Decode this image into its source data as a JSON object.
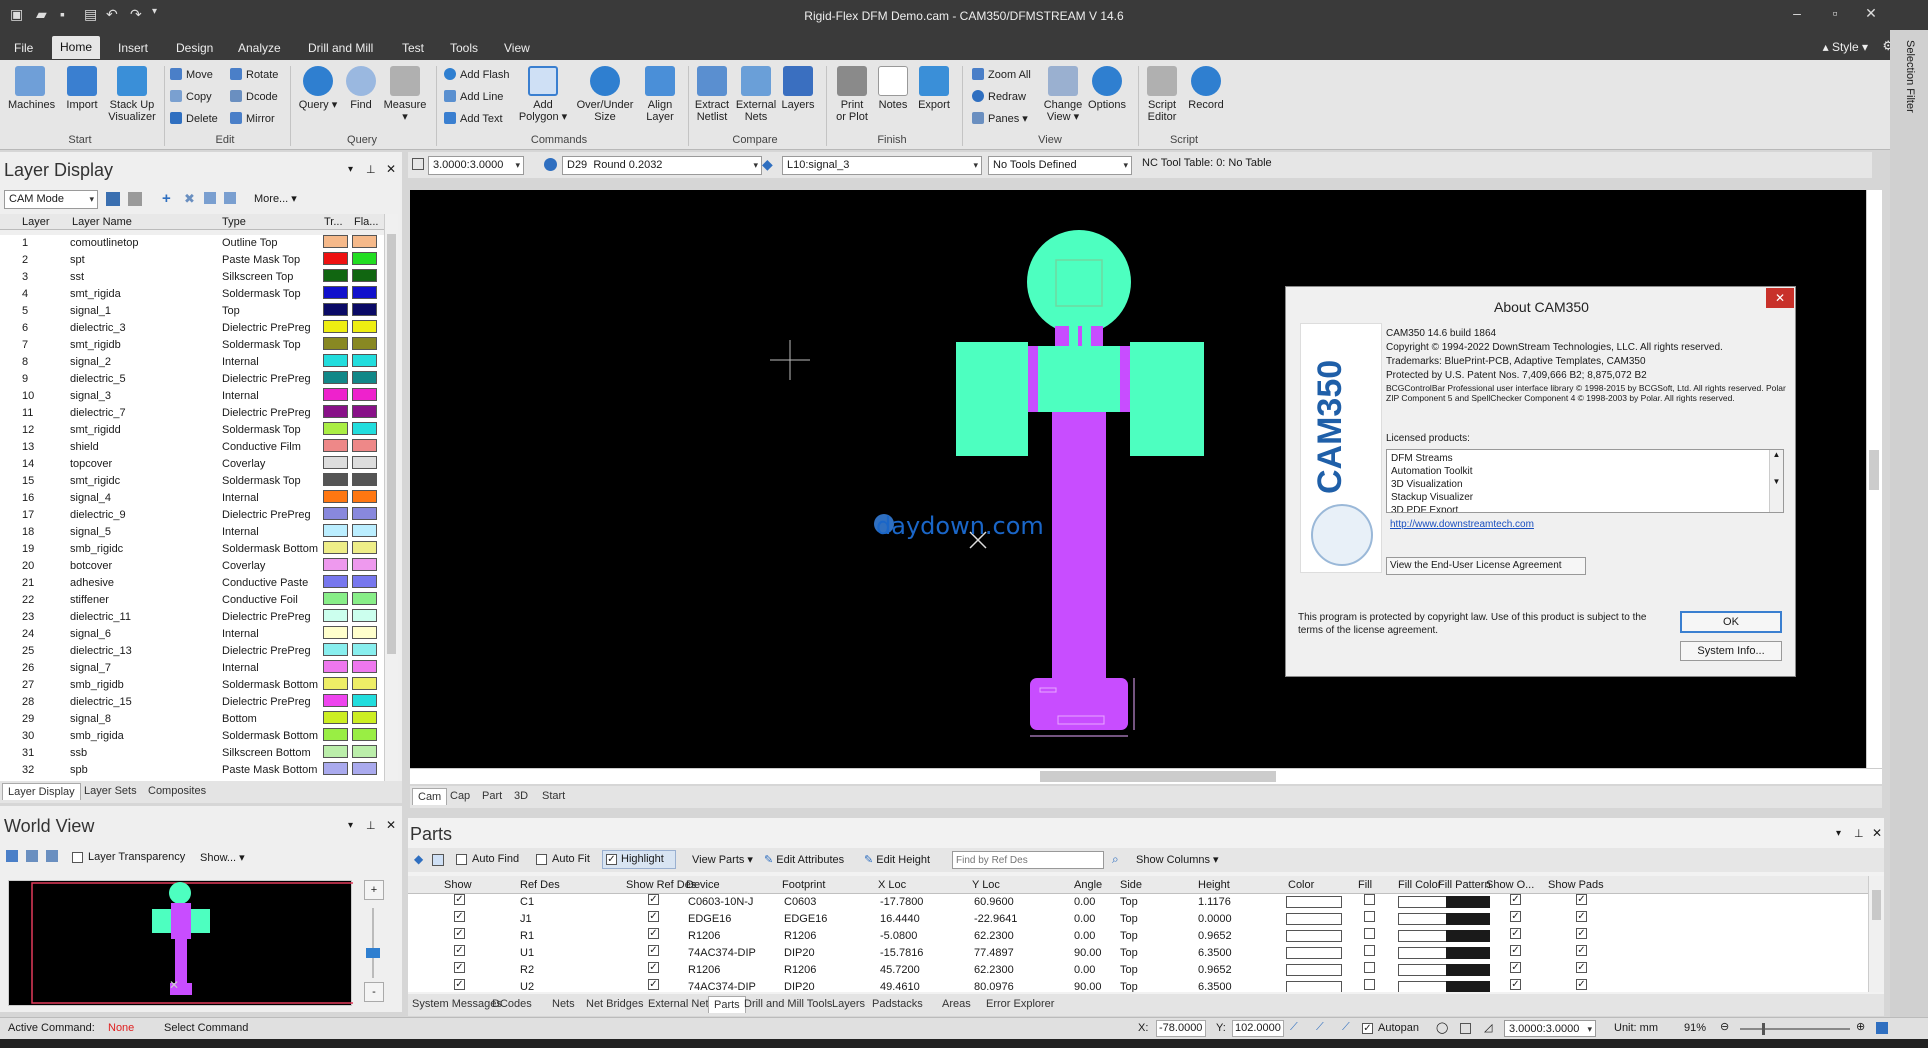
{
  "title": "Rigid-Flex DFM Demo.cam - CAM350/DFMSTREAM V 14.6",
  "menu": {
    "items": [
      "File",
      "Home",
      "Insert",
      "Design",
      "Analyze",
      "Drill and Mill",
      "Test",
      "Tools",
      "View"
    ],
    "style": "Style"
  },
  "ribbon": {
    "start": {
      "label": "Start",
      "machines": "Machines",
      "import": "Import",
      "stackup": "Stack Up",
      "visualizer": "Visualizer"
    },
    "edit": {
      "label": "Edit",
      "move": "Move",
      "copy": "Copy",
      "delete": "Delete",
      "rotate": "Rotate",
      "dcode": "Dcode",
      "mirror": "Mirror"
    },
    "query": {
      "label": "Query",
      "query": "Query",
      "find": "Find",
      "measure": "Measure"
    },
    "commands": {
      "label": "Commands",
      "add_flash": "Add Flash",
      "add_line": "Add Line",
      "add_text": "Add Text",
      "add": "Add",
      "polygon": "Polygon",
      "over_under": "Over/Under",
      "size": "Size",
      "align": "Align",
      "layer": "Layer"
    },
    "compare": {
      "label": "Compare",
      "extract": "Extract",
      "netlist": "Netlist",
      "external": "External",
      "nets": "Nets",
      "layers": "Layers"
    },
    "finish": {
      "label": "Finish",
      "print": "Print",
      "or_plot": "or Plot",
      "notes": "Notes",
      "export": "Export"
    },
    "view": {
      "label": "View",
      "zoom_all": "Zoom All",
      "redraw": "Redraw",
      "panes": "Panes",
      "change": "Change",
      "view": "View",
      "options": "Options"
    },
    "script": {
      "label": "Script",
      "script": "Script",
      "editor": "Editor",
      "record": "Record"
    }
  },
  "layer_display": {
    "title": "Layer Display",
    "mode": "CAM Mode",
    "more": "More...",
    "col_layer": "Layer",
    "col_name": "Layer Name",
    "col_type": "Type",
    "col_tr": "Tr...",
    "col_fla": "Fla...",
    "rows": [
      {
        "n": "1",
        "name": "comoutlinetop",
        "type": "Outline Top",
        "c1": "#f5b98a",
        "c2": "#f5b98a"
      },
      {
        "n": "2",
        "name": "spt",
        "type": "Paste Mask Top",
        "c1": "#ee1111",
        "c2": "#22dd22"
      },
      {
        "n": "3",
        "name": "sst",
        "type": "Silkscreen Top",
        "c1": "#116611",
        "c2": "#116611"
      },
      {
        "n": "4",
        "name": "smt_rigida",
        "type": "Soldermask Top",
        "c1": "#1111cc",
        "c2": "#1111cc"
      },
      {
        "n": "5",
        "name": "signal_1",
        "type": "Top",
        "c1": "#0a0a66",
        "c2": "#0a0a66"
      },
      {
        "n": "6",
        "name": "dielectric_3",
        "type": "Dielectric PrePreg",
        "c1": "#eeee11",
        "c2": "#eeee11"
      },
      {
        "n": "7",
        "name": "smt_rigidb",
        "type": "Soldermask Top",
        "c1": "#888822",
        "c2": "#888822"
      },
      {
        "n": "8",
        "name": "signal_2",
        "type": "Internal",
        "c1": "#22dddd",
        "c2": "#22dddd"
      },
      {
        "n": "9",
        "name": "dielectric_5",
        "type": "Dielectric PrePreg",
        "c1": "#118888",
        "c2": "#118888"
      },
      {
        "n": "10",
        "name": "signal_3",
        "type": "Internal",
        "c1": "#ee22cc",
        "c2": "#ee22cc"
      },
      {
        "n": "11",
        "name": "dielectric_7",
        "type": "Dielectric PrePreg",
        "c1": "#881188",
        "c2": "#881188"
      },
      {
        "n": "12",
        "name": "smt_rigidd",
        "type": "Soldermask Top",
        "c1": "#aaee44",
        "c2": "#22dddd"
      },
      {
        "n": "13",
        "name": "shield",
        "type": "Conductive Film",
        "c1": "#ee8888",
        "c2": "#ee8888"
      },
      {
        "n": "14",
        "name": "topcover",
        "type": "Coverlay",
        "c1": "#dddddd",
        "c2": "#dddddd"
      },
      {
        "n": "15",
        "name": "smt_rigidc",
        "type": "Soldermask Top",
        "c1": "#555555",
        "c2": "#555555"
      },
      {
        "n": "16",
        "name": "signal_4",
        "type": "Internal",
        "c1": "#ff7711",
        "c2": "#ff7711"
      },
      {
        "n": "17",
        "name": "dielectric_9",
        "type": "Dielectric PrePreg",
        "c1": "#8888dd",
        "c2": "#8888dd"
      },
      {
        "n": "18",
        "name": "signal_5",
        "type": "Internal",
        "c1": "#bbeeff",
        "c2": "#bbeeff"
      },
      {
        "n": "19",
        "name": "smb_rigidc",
        "type": "Soldermask Bottom",
        "c1": "#eeee88",
        "c2": "#eeee88"
      },
      {
        "n": "20",
        "name": "botcover",
        "type": "Coverlay",
        "c1": "#ee99ee",
        "c2": "#ee99ee"
      },
      {
        "n": "21",
        "name": "adhesive",
        "type": "Conductive Paste",
        "c1": "#7777ee",
        "c2": "#7777ee"
      },
      {
        "n": "22",
        "name": "stiffener",
        "type": "Conductive Foil",
        "c1": "#88ee88",
        "c2": "#88ee88"
      },
      {
        "n": "23",
        "name": "dielectric_11",
        "type": "Dielectric PrePreg",
        "c1": "#ccffee",
        "c2": "#ccffee"
      },
      {
        "n": "24",
        "name": "signal_6",
        "type": "Internal",
        "c1": "#ffffcc",
        "c2": "#ffffcc"
      },
      {
        "n": "25",
        "name": "dielectric_13",
        "type": "Dielectric PrePreg",
        "c1": "#88eeee",
        "c2": "#88eeee"
      },
      {
        "n": "26",
        "name": "signal_7",
        "type": "Internal",
        "c1": "#ee77ee",
        "c2": "#ee77ee"
      },
      {
        "n": "27",
        "name": "smb_rigidb",
        "type": "Soldermask Bottom",
        "c1": "#eeee66",
        "c2": "#eeee66"
      },
      {
        "n": "28",
        "name": "dielectric_15",
        "type": "Dielectric PrePreg",
        "c1": "#ee44ee",
        "c2": "#22dddd"
      },
      {
        "n": "29",
        "name": "signal_8",
        "type": "Bottom",
        "c1": "#ccee22",
        "c2": "#ccee22"
      },
      {
        "n": "30",
        "name": "smb_rigida",
        "type": "Soldermask Bottom",
        "c1": "#99ee44",
        "c2": "#99ee44"
      },
      {
        "n": "31",
        "name": "ssb",
        "type": "Silkscreen Bottom",
        "c1": "#bbeeaa",
        "c2": "#bbeeaa"
      },
      {
        "n": "32",
        "name": "spb",
        "type": "Paste Mask Bottom",
        "c1": "#aaaaee",
        "c2": "#aaaaee"
      }
    ],
    "tabs": [
      "Layer Display",
      "Layer Sets",
      "Composites"
    ]
  },
  "world_view": {
    "title": "World View",
    "transparency": "Layer Transparency",
    "show": "Show..."
  },
  "toolbar2": {
    "grid": "3.0000:3.0000",
    "dcode": "D29",
    "aperture": "Round 0.2032",
    "layer": "L10:signal_3",
    "tools": "No Tools Defined",
    "nc": "NC Tool Table: 0: No Table"
  },
  "canvas": {
    "watermark": "daydown.com",
    "tabs": [
      "Cam",
      "Cap",
      "Part",
      "3D",
      "Start"
    ]
  },
  "about": {
    "title": "About CAM350",
    "logo": "CAM350",
    "build": "CAM350 14.6 build 1864",
    "copyright": "Copyright © 1994-2022 DownStream Technologies, LLC. All rights reserved.",
    "trademarks": "Trademarks: BluePrint-PCB, Adaptive Templates, CAM350",
    "patent": "Protected by U.S. Patent Nos. 7,409,666 B2;  8,875,072 B2",
    "bcg": "BCGControlBar Professional user interface library © 1998-2015 by BCGSoft, Ltd. All rights reserved. Polar ZIP Component 5 and SpellChecker Component 4 © 1998-2003 by Polar. All rights reserved.",
    "licensed_label": "Licensed products:",
    "licensed": [
      "DFM Streams",
      "Automation Toolkit",
      "3D Visualization",
      "Stackup Visualizer",
      "3D PDF Export"
    ],
    "link": "http://www.downstreamtech.com",
    "eula": "View the End-User License Agreement",
    "protected": "This program is protected by copyright law. Use of this product is subject to the terms of the license agreement.",
    "ok": "OK",
    "sysinfo": "System Info..."
  },
  "parts": {
    "title": "Parts",
    "auto_find": "Auto Find",
    "auto_fit": "Auto Fit",
    "highlight": "Highlight",
    "view_parts": "View Parts",
    "edit_attributes": "Edit Attributes",
    "edit_height": "Edit Height",
    "find_placeholder": "Find by Ref Des",
    "show_columns": "Show Columns",
    "columns": [
      "Show",
      "Ref Des",
      "Show Ref Des",
      "Device",
      "Footprint",
      "X Loc",
      "Y Loc",
      "Angle",
      "Side",
      "Height",
      "Color",
      "Fill",
      "Fill Color",
      "Fill Pattern",
      "Show O...",
      "Show Pads"
    ],
    "rows": [
      {
        "ref": "C1",
        "device": "C0603-10N-J",
        "fp": "C0603",
        "x": "-17.7800",
        "y": "60.9600",
        "angle": "0.00",
        "side": "Top",
        "height": "1.1176"
      },
      {
        "ref": "J1",
        "device": "EDGE16",
        "fp": "EDGE16",
        "x": "16.4440",
        "y": "-22.9641",
        "angle": "0.00",
        "side": "Top",
        "height": "0.0000"
      },
      {
        "ref": "R1",
        "device": "R1206",
        "fp": "R1206",
        "x": "-5.0800",
        "y": "62.2300",
        "angle": "0.00",
        "side": "Top",
        "height": "0.9652"
      },
      {
        "ref": "U1",
        "device": "74AC374-DIP",
        "fp": "DIP20",
        "x": "-15.7816",
        "y": "77.4897",
        "angle": "90.00",
        "side": "Top",
        "height": "6.3500"
      },
      {
        "ref": "R2",
        "device": "R1206",
        "fp": "R1206",
        "x": "45.7200",
        "y": "62.2300",
        "angle": "0.00",
        "side": "Top",
        "height": "0.9652"
      },
      {
        "ref": "U2",
        "device": "74AC374-DIP",
        "fp": "DIP20",
        "x": "49.4610",
        "y": "80.0976",
        "angle": "90.00",
        "side": "Top",
        "height": "6.3500"
      }
    ]
  },
  "bottom_tabs": [
    "System Messages",
    "DCodes",
    "Nets",
    "Net Bridges",
    "External Nets",
    "Parts",
    "Drill and Mill Tools",
    "Layers",
    "Padstacks",
    "Areas",
    "Error Explorer"
  ],
  "status": {
    "active_label": "Active Command:",
    "active_value": "None",
    "select": "Select Command",
    "x_label": "X:",
    "x": "-78.0000",
    "y_label": "Y:",
    "y": "102.0000",
    "autopan": "Autopan",
    "grid": "3.0000:3.0000",
    "unit": "Unit: mm",
    "zoom": "91%"
  },
  "side_filter": "Selection Filter"
}
